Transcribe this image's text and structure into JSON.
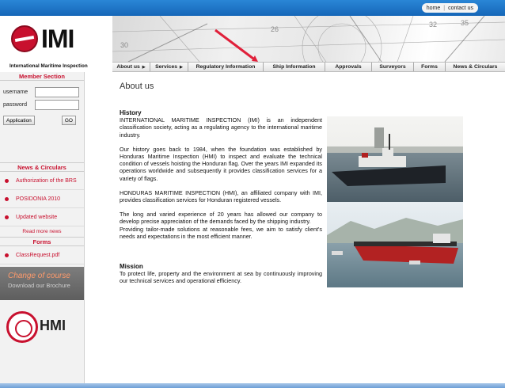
{
  "toplinks": {
    "home": "home",
    "separator": "|",
    "contact": "contact us"
  },
  "logo": {
    "title": "IMI",
    "subtitle": "International Maritime Inspection"
  },
  "nav": [
    {
      "label": "About us",
      "has_arrow": true
    },
    {
      "label": "Services",
      "has_arrow": true
    },
    {
      "label": "Regulatory Information",
      "has_arrow": false
    },
    {
      "label": "Ship Information",
      "has_arrow": false
    },
    {
      "label": "Approvals",
      "has_arrow": false
    },
    {
      "label": "Surveyors",
      "has_arrow": false
    },
    {
      "label": "Forms",
      "has_arrow": false
    },
    {
      "label": "News & Circulars",
      "has_arrow": false
    }
  ],
  "nav_arrow": "▶",
  "member": {
    "title": "Member Section",
    "username_label": "username",
    "password_label": "password",
    "username_value": "",
    "password_value": "",
    "application_button": "Application",
    "go_button": "GO"
  },
  "news": {
    "title": "News & Circulars",
    "items": [
      "Authorization of the BRS",
      "POSIDONIA 2010",
      "Updated website"
    ],
    "read_more": "Read more news"
  },
  "forms": {
    "title": "Forms",
    "items": [
      "ClassRequest.pdf"
    ]
  },
  "brochure": {
    "line1": "Change of course",
    "line2": "Download our Brochure"
  },
  "seal": {
    "text": "HMI"
  },
  "content": {
    "page_title": "About us",
    "history_heading": "History",
    "paragraphs": [
      "INTERNATIONAL MARITIME INSPECTION (IMI) is an independent classification society, acting as a regulating agency to the international maritime industry.",
      "Our history goes back to 1984, when the foundation was established by Honduras Maritime Inspection (HMI) to inspect and evaluate the technical condition of vessels hoisting the Honduran flag. Over the years IMI expanded its operations worldwide and subsequently it provides classification services for a variety of flags.",
      "HONDURAS MARITIME INSPECTION (HMI), an affiliated company with IMI, provides classification services for Honduran registered vessels.",
      "The long and varied experience of 20 years has allowed our company to develop precise appreciation of the demands faced by the shipping industry.",
      "Providing tailor-made solutions at reasonable fees, we aim to satisfy client's needs and expectations in the most efficient manner."
    ],
    "mission_heading": "Mission",
    "mission_text": "To protect life, property and the environment at sea by continuously improving our technical services and operational efficiency."
  },
  "colors": {
    "accent": "#c8102e",
    "topbar": "#1566b8"
  }
}
